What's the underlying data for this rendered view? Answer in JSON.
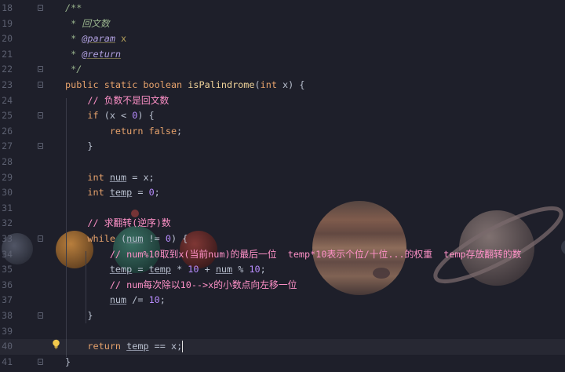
{
  "editor": {
    "lines": [
      {
        "n": "18",
        "tokens": [
          [
            "cm",
            "/**"
          ]
        ]
      },
      {
        "n": "19",
        "tokens": [
          [
            "cm",
            " * 回文数"
          ]
        ]
      },
      {
        "n": "20",
        "tokens": [
          [
            "cm",
            " * "
          ],
          [
            "tag",
            "@param"
          ],
          [
            "cm",
            " "
          ],
          [
            "param",
            "x"
          ]
        ]
      },
      {
        "n": "21",
        "tokens": [
          [
            "cm",
            " * "
          ],
          [
            "tag",
            "@return"
          ]
        ]
      },
      {
        "n": "22",
        "tokens": [
          [
            "cm",
            " */"
          ]
        ]
      },
      {
        "n": "23",
        "tokens": [
          [
            "kw",
            "public static boolean "
          ],
          [
            "fn",
            "isPalindrome"
          ],
          [
            "p",
            "("
          ],
          [
            "kw",
            "int"
          ],
          [
            "p",
            " x) {"
          ]
        ]
      },
      {
        "n": "24",
        "tokens": [
          [
            "cm2",
            "    // 负数不是回文数"
          ]
        ]
      },
      {
        "n": "25",
        "tokens": [
          [
            "kw",
            "    if"
          ],
          [
            "p",
            " (x < "
          ],
          [
            "num",
            "0"
          ],
          [
            "p",
            ") {"
          ]
        ]
      },
      {
        "n": "26",
        "tokens": [
          [
            "kw",
            "        return false"
          ],
          [
            "p",
            ";"
          ]
        ]
      },
      {
        "n": "27",
        "tokens": [
          [
            "p",
            "    }"
          ]
        ]
      },
      {
        "n": "28",
        "tokens": []
      },
      {
        "n": "29",
        "tokens": [
          [
            "kw",
            "    int "
          ],
          [
            "var",
            "num"
          ],
          [
            "p",
            " = x;"
          ]
        ]
      },
      {
        "n": "30",
        "tokens": [
          [
            "kw",
            "    int "
          ],
          [
            "var",
            "temp"
          ],
          [
            "p",
            " = "
          ],
          [
            "num",
            "0"
          ],
          [
            "p",
            ";"
          ]
        ]
      },
      {
        "n": "31",
        "tokens": []
      },
      {
        "n": "32",
        "tokens": [
          [
            "cm2",
            "    // 求翻转(逆序)数"
          ]
        ]
      },
      {
        "n": "33",
        "tokens": [
          [
            "kw",
            "    while"
          ],
          [
            "p",
            " ("
          ],
          [
            "var",
            "num"
          ],
          [
            "p",
            " != "
          ],
          [
            "num",
            "0"
          ],
          [
            "p",
            ") {"
          ]
        ]
      },
      {
        "n": "34",
        "tokens": [
          [
            "cm2",
            "        // num%10取到x(当前num)的最后一位  temp*10表示个位/十位...的权重  temp存放翻转的数"
          ]
        ]
      },
      {
        "n": "35",
        "tokens": [
          [
            "p",
            "        "
          ],
          [
            "var",
            "temp"
          ],
          [
            "p",
            " = "
          ],
          [
            "var",
            "temp"
          ],
          [
            "p",
            " * "
          ],
          [
            "num",
            "10"
          ],
          [
            "p",
            " + "
          ],
          [
            "var",
            "num"
          ],
          [
            "p",
            " % "
          ],
          [
            "num",
            "10"
          ],
          [
            "p",
            ";"
          ]
        ]
      },
      {
        "n": "36",
        "tokens": [
          [
            "cm2",
            "        // num每次除以10-->x的小数点向左移一位"
          ]
        ]
      },
      {
        "n": "37",
        "tokens": [
          [
            "p",
            "        "
          ],
          [
            "var",
            "num"
          ],
          [
            "p",
            " /= "
          ],
          [
            "num",
            "10"
          ],
          [
            "p",
            ";"
          ]
        ]
      },
      {
        "n": "38",
        "tokens": [
          [
            "p",
            "    }"
          ]
        ]
      },
      {
        "n": "39",
        "tokens": []
      },
      {
        "n": "40",
        "tokens": [
          [
            "kw",
            "    return "
          ],
          [
            "var",
            "temp"
          ],
          [
            "p",
            " == x;"
          ]
        ]
      },
      {
        "n": "41",
        "tokens": [
          [
            "p",
            "}"
          ]
        ]
      }
    ],
    "current_line": "40",
    "fold_lines": [
      "18",
      "22",
      "23",
      "25",
      "27",
      "33",
      "38",
      "41"
    ],
    "intention_icon": "lightbulb-icon"
  },
  "colors": {
    "background": "#1e1f2a",
    "keyword": "#e6a26c",
    "function": "#f0d39a",
    "number": "#b88cff",
    "comment": "#ff91c8",
    "doc_comment": "#9ab58e"
  }
}
